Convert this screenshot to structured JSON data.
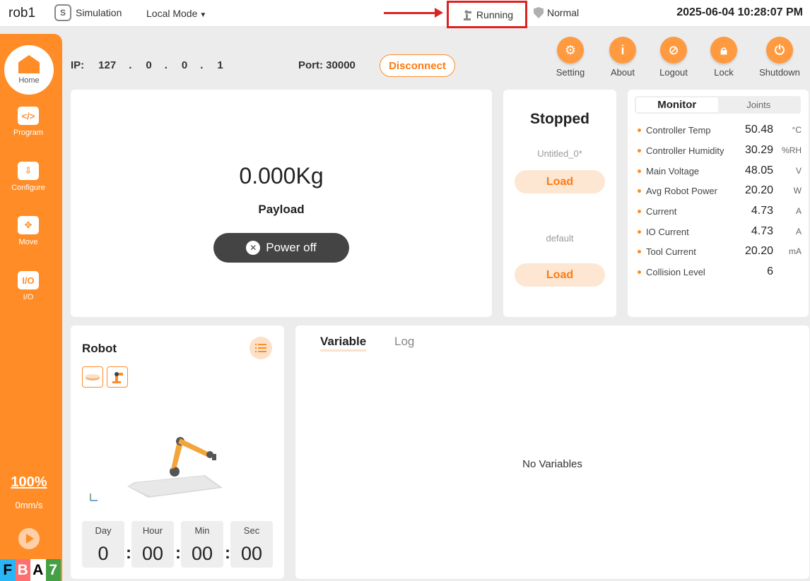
{
  "topbar": {
    "app_name": "rob1",
    "simulation_label": "Simulation",
    "simulation_badge": "S",
    "mode_label": "Local Mode",
    "status_label": "Running",
    "safety_label": "Normal",
    "datetime": "2025-06-04 10:28:07 PM"
  },
  "sidebar": {
    "home_label": "Home",
    "items": [
      {
        "label": "Program",
        "icon": "</>"
      },
      {
        "label": "Configure",
        "icon": "⇩"
      },
      {
        "label": "Move",
        "icon": "✥"
      },
      {
        "label": "I/O",
        "icon": "I/O"
      }
    ],
    "speed_percent": "100%",
    "speed_mm": "0mm/s",
    "badges": [
      "F",
      "B",
      "A",
      "7"
    ]
  },
  "connection": {
    "ip_label": "IP:",
    "ip_parts": [
      "127",
      "0",
      "0",
      "1"
    ],
    "ip_dot": ".",
    "port_label": "Port: 30000",
    "disconnect_label": "Disconnect"
  },
  "tools": [
    {
      "label": "Setting",
      "icon": "gear-icon"
    },
    {
      "label": "About",
      "icon": "info-icon"
    },
    {
      "label": "Logout",
      "icon": "logout-icon"
    },
    {
      "label": "Lock",
      "icon": "lock-icon"
    },
    {
      "label": "Shutdown",
      "icon": "power-icon"
    }
  ],
  "payload": {
    "value": "0.000Kg",
    "label": "Payload",
    "power_button": "Power off"
  },
  "program": {
    "state": "Stopped",
    "program_name": "Untitled_0*",
    "load_label": "Load",
    "default_name": "default",
    "load_label_2": "Load"
  },
  "monitor": {
    "tabs": [
      "Monitor",
      "Joints"
    ],
    "rows": [
      {
        "label": "Controller Temp",
        "value": "50.48",
        "unit": "°C"
      },
      {
        "label": "Controller Humidity",
        "value": "30.29",
        "unit": "%RH"
      },
      {
        "label": "Main Voltage",
        "value": "48.05",
        "unit": "V"
      },
      {
        "label": "Avg Robot Power",
        "value": "20.20",
        "unit": "W"
      },
      {
        "label": "Current",
        "value": "4.73",
        "unit": "A"
      },
      {
        "label": "IO Current",
        "value": "4.73",
        "unit": "A"
      },
      {
        "label": "Tool Current",
        "value": "20.20",
        "unit": "mA"
      },
      {
        "label": "Collision Level",
        "value": "6",
        "unit": ""
      }
    ]
  },
  "robot": {
    "title": "Robot",
    "timer": {
      "labels": [
        "Day",
        "Hour",
        "Min",
        "Sec"
      ],
      "values": [
        "0",
        "00",
        "00",
        "00"
      ],
      "separator": ":"
    }
  },
  "variables": {
    "tabs": [
      "Variable",
      "Log"
    ],
    "empty_text": "No Variables"
  },
  "colors": {
    "accent": "#ff8c26",
    "highlight_box": "#dd2222"
  }
}
